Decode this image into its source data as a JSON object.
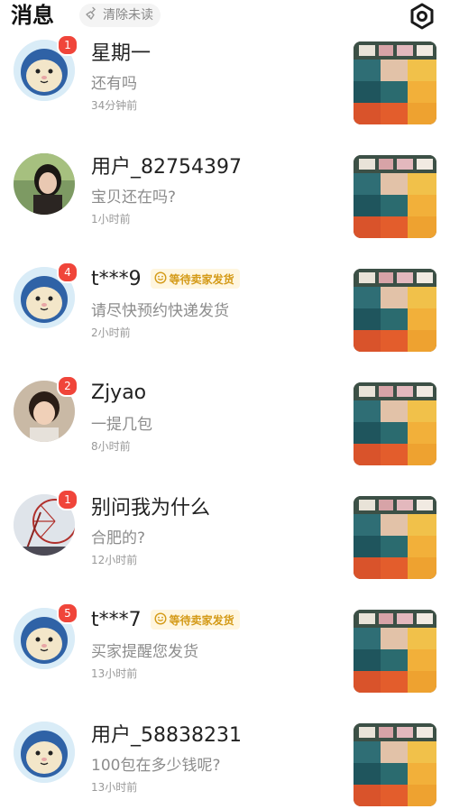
{
  "header": {
    "title": "消息",
    "clear_label": "清除未读",
    "settings_icon": "settings-hexagon-icon",
    "clear_icon": "broom-icon"
  },
  "colors": {
    "badge": "#f0453a",
    "tag_bg": "#fff6df",
    "tag_text": "#d49a17",
    "muted": "#8c8c8c"
  },
  "conversations": [
    {
      "name": "星期一",
      "message": "还有吗",
      "time": "34分钟前",
      "badge": "1",
      "avatar": "default-mascot-avatar",
      "tag": ""
    },
    {
      "name": "用户_82754397",
      "message": "宝贝还在吗?",
      "time": "1小时前",
      "badge": "",
      "avatar": "user-photo-avatar",
      "tag": ""
    },
    {
      "name": "t***9",
      "message": "请尽快预约快递发货",
      "time": "2小时前",
      "badge": "4",
      "avatar": "default-mascot-avatar",
      "tag": "等待卖家发货"
    },
    {
      "name": "Zjyao",
      "message": "一提几包",
      "time": "8小时前",
      "badge": "2",
      "avatar": "child-photo-avatar",
      "tag": ""
    },
    {
      "name": "别问我为什么",
      "message": "合肥的?",
      "time": "12小时前",
      "badge": "1",
      "avatar": "ferris-wheel-avatar",
      "tag": ""
    },
    {
      "name": "t***7",
      "message": "买家提醒您发货",
      "time": "13小时前",
      "badge": "5",
      "avatar": "default-mascot-avatar",
      "tag": "等待卖家发货"
    },
    {
      "name": "用户_58838231",
      "message": "100包在多少钱呢?",
      "time": "13小时前",
      "badge": "",
      "avatar": "default-mascot-avatar",
      "tag": ""
    }
  ]
}
